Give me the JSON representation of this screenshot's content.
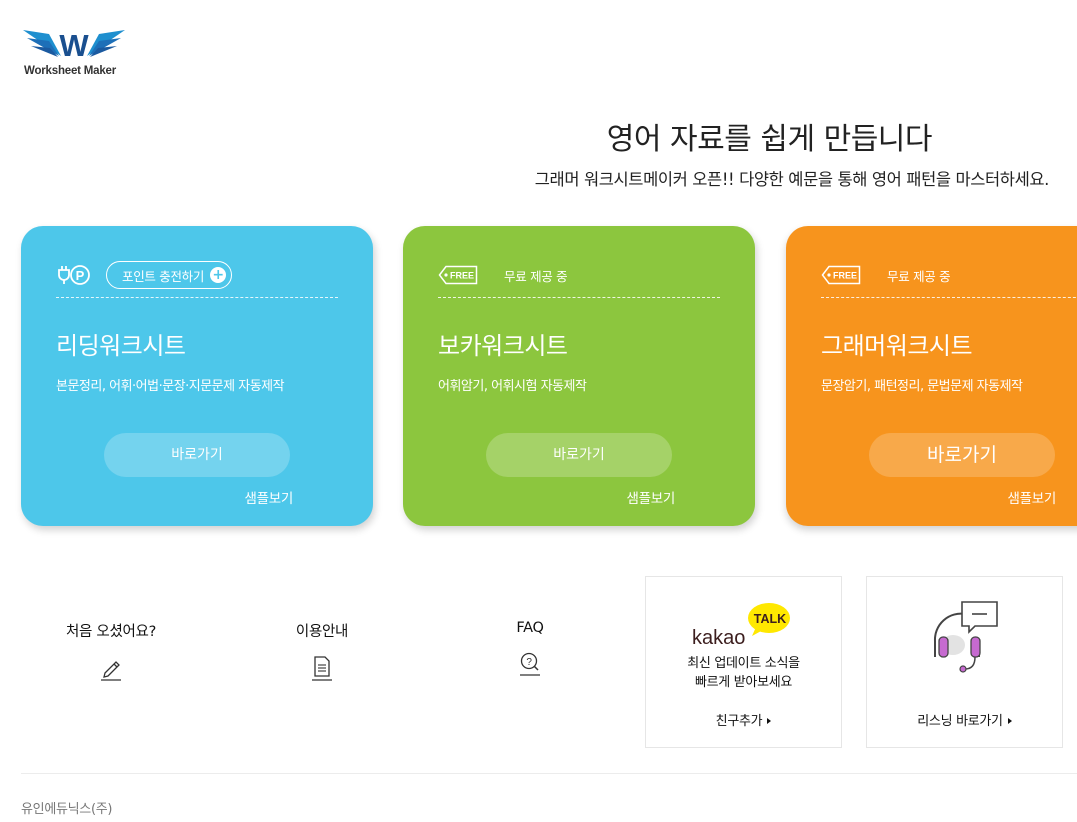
{
  "logo": {
    "text": "Worksheet Maker"
  },
  "hero": {
    "title": "영어 자료를 쉽게 만듭니다",
    "subtitle": "그래머 워크시트메이커 오픈!! 다양한 예문을 통해 영어 패턴을 마스터하세요."
  },
  "cards": [
    {
      "color": "#4dc7ea",
      "tag": "포인트 충전하기",
      "title": "리딩워크시트",
      "desc": "본문정리, 어휘·어법·문장·지문문제 자동제작",
      "button": "바로가기",
      "sample": "샘플보기"
    },
    {
      "color": "#8cc63e",
      "tag_icon": "FREE",
      "tag": "무료 제공 중",
      "title": "보카워크시트",
      "desc": "어휘암기, 어휘시험 자동제작",
      "button": "바로가기",
      "sample": "샘플보기"
    },
    {
      "color": "#f7941d",
      "tag_icon": "FREE",
      "tag": "무료 제공 중",
      "title": "그래머워크시트",
      "desc": "문장암기, 패턴정리, 문법문제 자동제작",
      "button": "바로가기",
      "sample": "샘플보기"
    }
  ],
  "info": [
    {
      "label": "처음 오셨어요?",
      "icon": "pencil-icon"
    },
    {
      "label": "이용안내",
      "icon": "document-icon"
    },
    {
      "label": "FAQ",
      "icon": "question-search-icon"
    }
  ],
  "kakao": {
    "logo_text": "kakao",
    "talk": "TALK",
    "line1": "최신 업데이트 소식을",
    "line2": "빠르게 받아보세요",
    "link": "친구추가"
  },
  "listening": {
    "link": "리스닝 바로가기"
  },
  "footer": {
    "company": "유인에듀닉스(주)"
  }
}
